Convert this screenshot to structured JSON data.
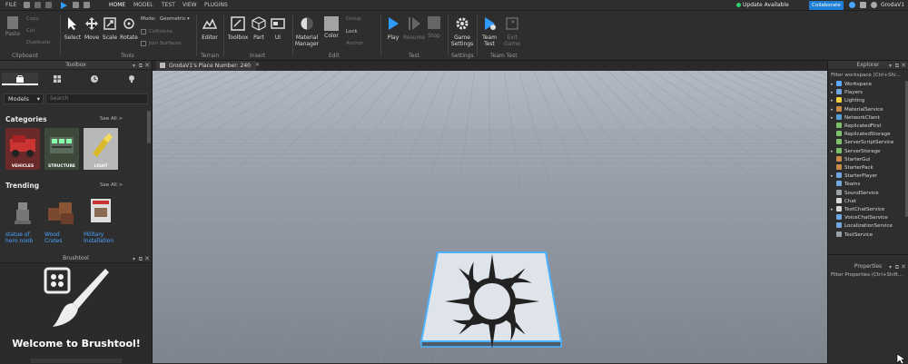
{
  "menubar": {
    "file": "FILE",
    "tabs": [
      "HOME",
      "MODEL",
      "TEST",
      "VIEW",
      "PLUGINS"
    ],
    "update_text": "Update Available",
    "collaborate": "Collaborate",
    "user": "GrodaV1"
  },
  "ribbon": {
    "clipboard": {
      "paste": "Paste",
      "copy": "Copy",
      "cut": "Cut",
      "duplicate": "Duplicate",
      "group": "Clipboard"
    },
    "tools": {
      "select": "Select",
      "move": "Move",
      "scale": "Scale",
      "rotate": "Rotate",
      "group": "Tools",
      "mode_label": "Mode:",
      "mode_value": "Geometric",
      "collisions": "Collisions",
      "join_surfaces": "Join Surfaces"
    },
    "terrain": {
      "editor": "Editor",
      "group": "Terrain"
    },
    "insert": {
      "toolbox": "Toolbox",
      "part": "Part",
      "ui": "UI",
      "group": "Insert"
    },
    "edit": {
      "material_manager": "Material\nManager",
      "color": "Color",
      "group_btn": "Group",
      "lock": "Lock",
      "anchor": "Anchor",
      "group": "Edit"
    },
    "test": {
      "play": "Play",
      "resume": "Resume",
      "stop": "Stop",
      "group": "Test"
    },
    "settings": {
      "game_settings": "Game\nSettings",
      "group": "Settings"
    },
    "team_test": {
      "team_test": "Team\nTest",
      "exit_game": "Exit\nGame",
      "group": "Team Test"
    }
  },
  "toolbox": {
    "title": "Toolbox",
    "category_dropdown": "Models",
    "search_placeholder": "Search",
    "categories_title": "Categories",
    "see_all": "See All >",
    "categories": [
      "VEHICLES",
      "STRUCTURE",
      "LIGHT"
    ],
    "trending_title": "Trending",
    "trending": [
      "statue of\nhero noob",
      "Wood\nCrates",
      "Military\nInstallation"
    ]
  },
  "brushtool": {
    "title": "Brushtool",
    "welcome": "Welcome to Brushtool!"
  },
  "document_tab": "GrodaV1's Place Number: 240",
  "explorer": {
    "title": "Explorer",
    "filter": "Filter workspace (Ctrl+Shi...",
    "items": [
      {
        "name": "Workspace",
        "expand": true,
        "color": "#5fa8ff"
      },
      {
        "name": "Players",
        "expand": true,
        "color": "#6fa7e0"
      },
      {
        "name": "Lighting",
        "expand": true,
        "color": "#f1d03b"
      },
      {
        "name": "MaterialService",
        "expand": true,
        "color": "#c98b48"
      },
      {
        "name": "NetworkClient",
        "expand": true,
        "color": "#56a2d6"
      },
      {
        "name": "ReplicatedFirst",
        "expand": false,
        "color": "#7cc06a"
      },
      {
        "name": "ReplicatedStorage",
        "expand": false,
        "color": "#7cc06a"
      },
      {
        "name": "ServerScriptService",
        "expand": false,
        "color": "#7cc06a"
      },
      {
        "name": "ServerStorage",
        "expand": true,
        "color": "#7cc06a"
      },
      {
        "name": "StarterGui",
        "expand": false,
        "color": "#c98b48"
      },
      {
        "name": "StarterPack",
        "expand": false,
        "color": "#c98b48"
      },
      {
        "name": "StarterPlayer",
        "expand": true,
        "color": "#6fa7e0"
      },
      {
        "name": "Teams",
        "expand": false,
        "color": "#6fa7e0"
      },
      {
        "name": "SoundService",
        "expand": false,
        "color": "#9aa0a8"
      },
      {
        "name": "Chat",
        "expand": false,
        "color": "#d8d8d8"
      },
      {
        "name": "TextChatService",
        "expand": true,
        "color": "#d8d8d8"
      },
      {
        "name": "VoiceChatService",
        "expand": false,
        "color": "#6fa7e0"
      },
      {
        "name": "LocalizationService",
        "expand": false,
        "color": "#6fa7e0"
      },
      {
        "name": "TestService",
        "expand": false,
        "color": "#9aa0a8"
      }
    ]
  },
  "properties": {
    "title": "Properties",
    "filter": "Filter Properties (Ctrl+Shift..."
  },
  "colors": {
    "accent": "#1f7fd6",
    "link": "#4aa3ff",
    "selection": "#4ab2ff"
  }
}
